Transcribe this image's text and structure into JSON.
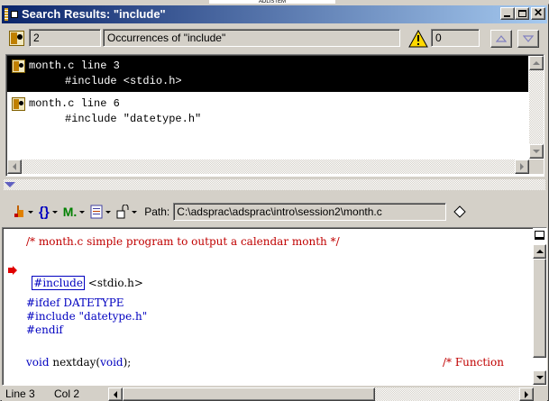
{
  "window": {
    "title": "Search Results: \"include\"",
    "background_fragment": "ADLISTEM"
  },
  "search_bar": {
    "count": "2",
    "occurrences_label": "Occurrences of \"include\"",
    "warning_count": "0"
  },
  "results": [
    {
      "location": "month.c line 3",
      "code": "#include <stdio.h>",
      "selected": true
    },
    {
      "location": "month.c line 6",
      "code": "#include \"datetype.h\"",
      "selected": false
    }
  ],
  "toolbar": {
    "path_label": "Path:",
    "path_value": "C:\\adsprac\\adsprac\\intro\\session2\\month.c"
  },
  "editor": {
    "comment_line": "/* month.c simple program to output a calendar month */",
    "include_keyword": "#include",
    "include_target": "<stdio.h>",
    "ifdef_line": "#ifdef DATETYPE",
    "include2_line": "#include \"datetype.h\"",
    "endif_line": "#endif",
    "decl_void": "void",
    "decl_name": "nextday(",
    "decl_param": "void",
    "decl_end": ");",
    "decl_comment": "/* Function"
  },
  "status": {
    "line": "Line 3",
    "col": "Col 2"
  },
  "colors": {
    "title_gradient_start": "#0a246a",
    "title_gradient_end": "#a6caf0",
    "selection_bg": "#000000",
    "comment": "#c00000",
    "keyword": "#0000c0",
    "marker": "#e00000"
  }
}
